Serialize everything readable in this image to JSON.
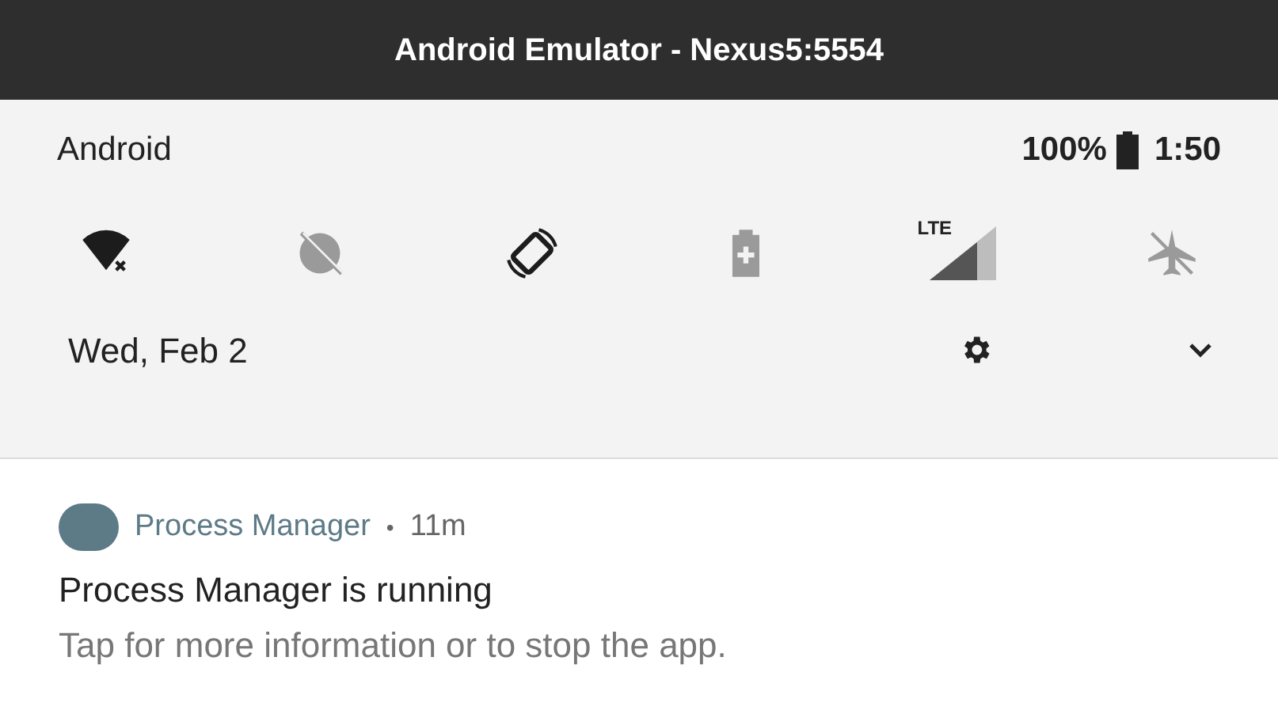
{
  "window": {
    "title": "Android Emulator - Nexus5:5554"
  },
  "status_bar": {
    "carrier": "Android",
    "battery": "100%",
    "time": "1:50"
  },
  "quick_settings": [
    {
      "kind": "wifi",
      "on": true
    },
    {
      "kind": "data-saver",
      "on": false
    },
    {
      "kind": "rotate",
      "on": true
    },
    {
      "kind": "battery-saver",
      "on": false
    },
    {
      "kind": "lte",
      "on": true,
      "label": "LTE"
    },
    {
      "kind": "airplane",
      "on": false
    }
  ],
  "date": "Wed, Feb 2",
  "notification": {
    "app": "Process Manager",
    "separator": "•",
    "age": "11m",
    "title": "Process Manager is running",
    "text": "Tap for more information or to stop the app."
  }
}
